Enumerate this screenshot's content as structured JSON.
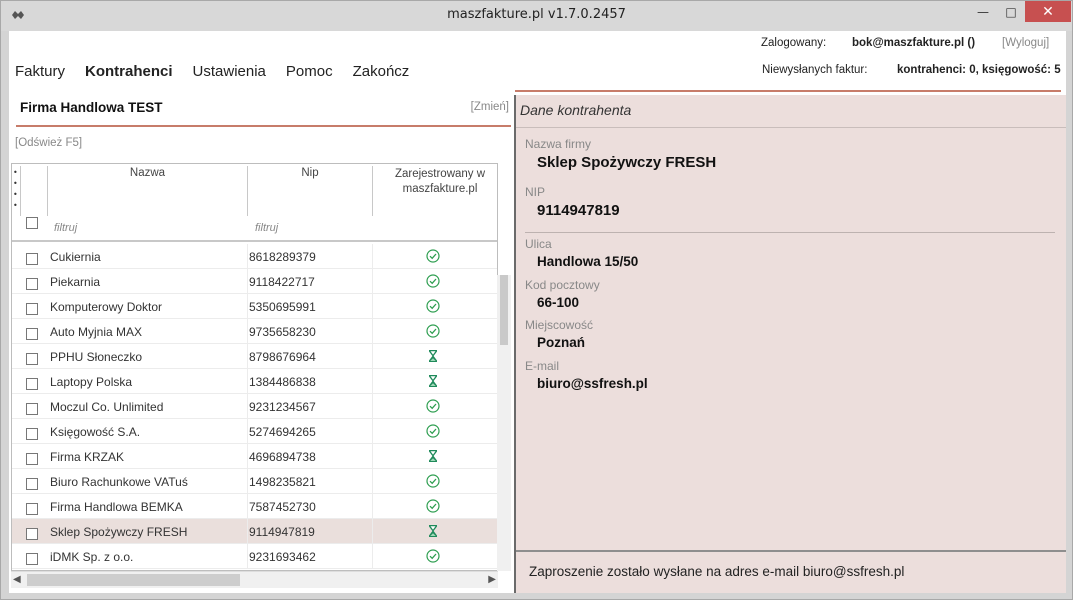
{
  "window": {
    "title": "maszfakture.pl  v1.7.0.2457",
    "min_glyph": "—",
    "max_glyph": "□",
    "close_glyph": "✕"
  },
  "menu": {
    "items": [
      "Faktury",
      "Kontrahenci",
      "Ustawienia",
      "Pomoc",
      "Zakończ"
    ],
    "active": "Kontrahenci"
  },
  "login": {
    "label": "Zalogowany:",
    "user": "bok@maszfakture.pl ()",
    "logout": "[Wyloguj]"
  },
  "unsent": {
    "label": "Niewysłanych faktur:",
    "value": "kontrahenci: 0, księgowość: 5"
  },
  "left": {
    "company": "Firma Handlowa TEST",
    "change": "[Zmień]",
    "refresh": "[Odśwież F5]",
    "columns": {
      "name": "Nazwa",
      "nip": "Nip",
      "registered": "Zarejestrowany w maszfakture.pl"
    },
    "filter_placeholder": "filtruj",
    "rows": [
      {
        "name": "Cukiernia",
        "nip": "8618289379",
        "status": "registered"
      },
      {
        "name": "Piekarnia",
        "nip": "9118422717",
        "status": "registered"
      },
      {
        "name": "Komputerowy Doktor",
        "nip": "5350695991",
        "status": "registered"
      },
      {
        "name": "Auto Myjnia MAX",
        "nip": "9735658230",
        "status": "registered"
      },
      {
        "name": "PPHU Słoneczko",
        "nip": "8798676964",
        "status": "pending"
      },
      {
        "name": "Laptopy Polska",
        "nip": "1384486838",
        "status": "pending"
      },
      {
        "name": "Moczul Co. Unlimited",
        "nip": "9231234567",
        "status": "registered"
      },
      {
        "name": "Księgowość S.A.",
        "nip": "5274694265",
        "status": "registered"
      },
      {
        "name": "Firma KRZAK",
        "nip": "4696894738",
        "status": "pending"
      },
      {
        "name": "Biuro Rachunkowe VATuś",
        "nip": "1498235821",
        "status": "registered"
      },
      {
        "name": "Firma Handlowa BEMKA",
        "nip": "7587452730",
        "status": "registered"
      },
      {
        "name": "Sklep Spożywczy FRESH",
        "nip": "9114947819",
        "status": "pending",
        "selected": true
      },
      {
        "name": "iDMK Sp. z o.o.",
        "nip": "9231693462",
        "status": "registered"
      }
    ]
  },
  "right": {
    "title": "Dane kontrahenta",
    "fields": {
      "company_label": "Nazwa firmy",
      "company": "Sklep Spożywczy FRESH",
      "nip_label": "NIP",
      "nip": "9114947819",
      "street_label": "Ulica",
      "street": "Handlowa 15/50",
      "postal_label": "Kod pocztowy",
      "postal": "66-100",
      "city_label": "Miejscowość",
      "city": "Poznań",
      "email_label": "E-mail",
      "email": "biuro@ssfresh.pl"
    },
    "status": "Zaproszenie zostało wysłane na adres e-mail biuro@ssfresh.pl"
  },
  "colors": {
    "accent": "#c77c6a",
    "selected_row": "#eadfdc",
    "detail_bg": "#ecdedc",
    "registered_icon": "#2e9e50",
    "pending_icon": "#1f8a5a"
  }
}
